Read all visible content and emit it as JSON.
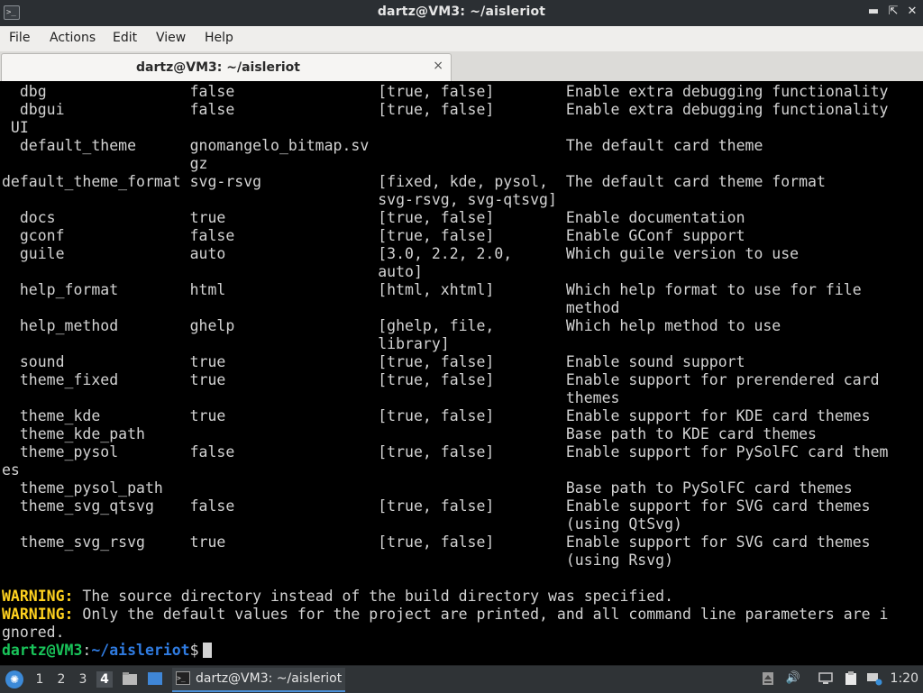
{
  "window": {
    "title": "dartz@VM3: ~/aisleriot"
  },
  "menu": [
    "File",
    "Actions",
    "Edit",
    "View",
    "Help"
  ],
  "tab": {
    "label": "dartz@VM3: ~/aisleriot",
    "close_symbol": "×"
  },
  "terminal": {
    "lines": [
      "  dbg                false                [true, false]        Enable extra debugging functionality",
      "  dbgui              false                [true, false]        Enable extra debugging functionality",
      " UI",
      "  default_theme      gnomangelo_bitmap.sv                      The default card theme",
      "                     gz",
      "default_theme_format svg-rsvg             [fixed, kde, pysol,  The default card theme format",
      "                                          svg-rsvg, svg-qtsvg]",
      "  docs               true                 [true, false]        Enable documentation",
      "  gconf              false                [true, false]        Enable GConf support",
      "  guile              auto                 [3.0, 2.2, 2.0,      Which guile version to use",
      "                                          auto]",
      "  help_format        html                 [html, xhtml]        Which help format to use for file",
      "                                                               method",
      "  help_method        ghelp                [ghelp, file,        Which help method to use",
      "                                          library]",
      "  sound              true                 [true, false]        Enable sound support",
      "  theme_fixed        true                 [true, false]        Enable support for prerendered card",
      "                                                               themes",
      "  theme_kde          true                 [true, false]        Enable support for KDE card themes",
      "  theme_kde_path                                               Base path to KDE card themes",
      "  theme_pysol        false                [true, false]        Enable support for PySolFC card them",
      "es",
      "  theme_pysol_path                                             Base path to PySolFC card themes",
      "  theme_svg_qtsvg    false                [true, false]        Enable support for SVG card themes",
      "                                                               (using QtSvg)",
      "  theme_svg_rsvg     true                 [true, false]        Enable support for SVG card themes",
      "                                                               (using Rsvg)",
      ""
    ],
    "warning_label": "WARNING:",
    "warning1": " The source directory instead of the build directory was specified.",
    "warning2": " Only the default values for the project are printed, and all command line parameters are i",
    "warning2_wrap": "gnored.",
    "prompt_user": "dartz@VM3",
    "prompt_sep": ":",
    "prompt_path": "~/aisleriot",
    "prompt_symbol": "$"
  },
  "taskbar": {
    "workspaces": [
      "1",
      "2",
      "3",
      "4"
    ],
    "active_workspace": "4",
    "task_label": "dartz@VM3: ~/aisleriot",
    "clock": "1:20"
  },
  "colors": {
    "warning": "#ffd21f",
    "prompt_user": "#19c45a",
    "prompt_path": "#2f7be0"
  }
}
